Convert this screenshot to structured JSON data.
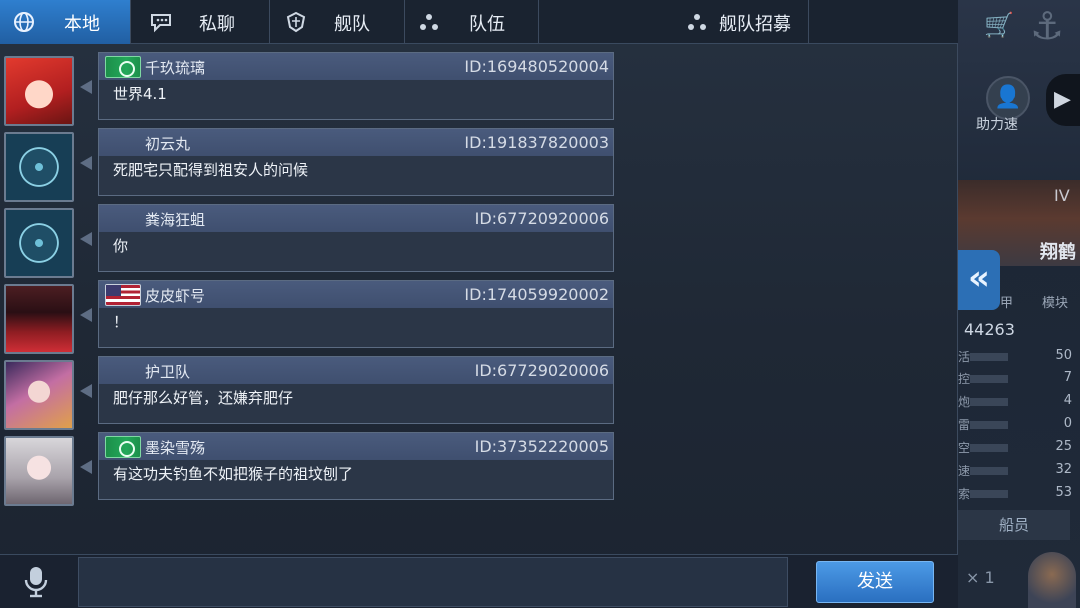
{
  "tabs": {
    "local": "本地",
    "private": "私聊",
    "fleet": "舰队",
    "team": "队伍",
    "recruit": "舰队招募",
    "active": "local"
  },
  "messages": [
    {
      "avatar": "red-hair-anime-girl",
      "flag": "green-emblem",
      "name": "千玖琉璃",
      "id": "ID:169480520004",
      "text": "世界4.1"
    },
    {
      "avatar": "emblem-logo",
      "flag": "",
      "name": "初云丸",
      "id": "ID:191837820003",
      "text": "死肥宅只配得到祖安人的问候"
    },
    {
      "avatar": "emblem-logo",
      "flag": "",
      "name": "粪海狂蛆",
      "id": "ID:67720920006",
      "text": "你"
    },
    {
      "avatar": "dark-warrior-red-saber",
      "flag": "us-flag",
      "name": "皮皮虾号",
      "id": "ID:174059920002",
      "text": "！"
    },
    {
      "avatar": "anime-girl-dark-hair",
      "flag": "",
      "name": "护卫队",
      "id": "ID:67729020006",
      "text": "肥仔那么好管，还嫌弃肥仔"
    },
    {
      "avatar": "white-hair-anime-girl",
      "flag": "green-emblem",
      "name": "墨染雪殇",
      "id": "ID:37352220005",
      "text": "有这功夫钓鱼不如把猴子的祖坟刨了"
    }
  ],
  "input": {
    "value": "",
    "placeholder": "",
    "send_label": "发送"
  },
  "background": {
    "badge_label": "助力速",
    "ship_tier": "IV",
    "ship_name": "翔鹤",
    "module_a": "甲",
    "module_b": "模块",
    "power": "44263",
    "stats": [
      {
        "label": "活",
        "value": "50"
      },
      {
        "label": "控",
        "value": "7"
      },
      {
        "label": "炮",
        "value": "4"
      },
      {
        "label": "雷",
        "value": "0"
      },
      {
        "label": "空",
        "value": "25"
      },
      {
        "label": "速",
        "value": "32"
      },
      {
        "label": "索",
        "value": "53"
      }
    ],
    "crew_label": "船员",
    "count": "× 1"
  },
  "colors": {
    "accent": "#2f7fcf",
    "send": "#3b86d6",
    "header": "#465778"
  },
  "icons": {
    "local": "globe-icon",
    "private": "chat-bubble-icon",
    "fleet": "fleet-emblem-icon",
    "team": "team-dots-icon",
    "recruit": "recruit-dots-icon",
    "mic": "microphone-icon",
    "collapse": "double-chevron-left-icon"
  }
}
